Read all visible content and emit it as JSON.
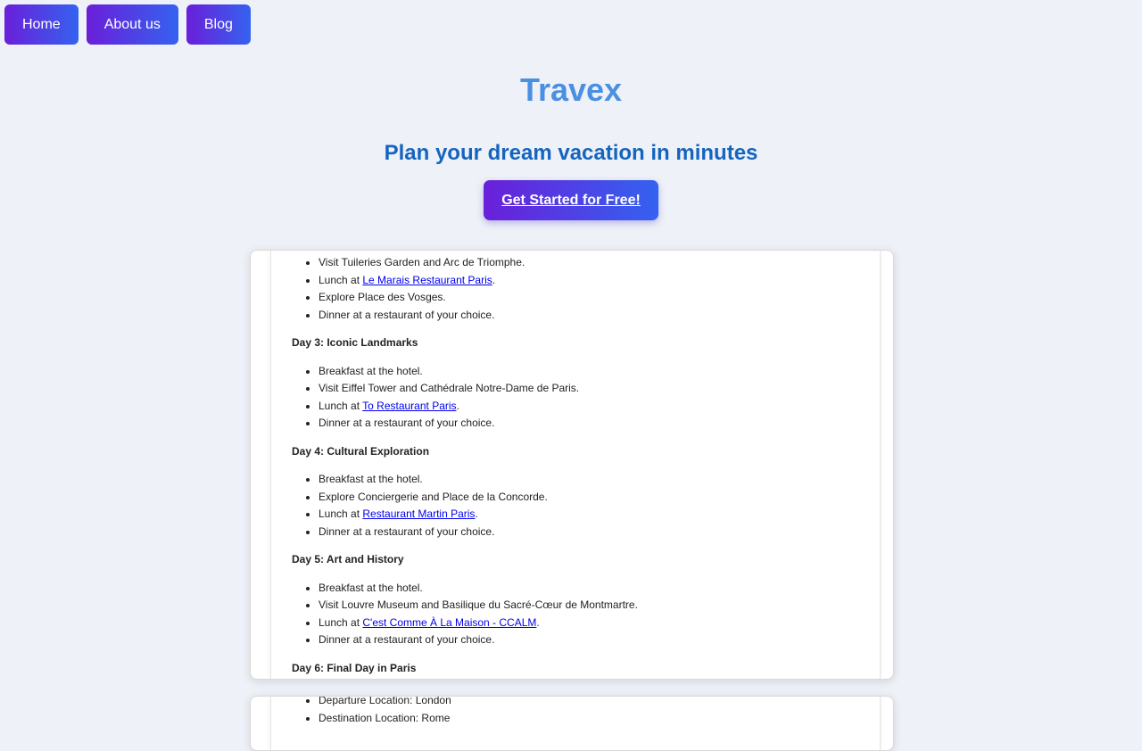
{
  "nav": {
    "home": "Home",
    "about": "About us",
    "blog": "Blog"
  },
  "hero": {
    "brand": "Travex",
    "tagline": "Plan your dream vacation in minutes",
    "cta": "Get Started for Free!"
  },
  "itinerary": {
    "day2_items": [
      {
        "text": "Visit Tuileries Garden and Arc de Triomphe."
      },
      {
        "pre": "Lunch at ",
        "link": "Le Marais Restaurant Paris",
        "post": "."
      },
      {
        "text": "Explore Place des Vosges."
      },
      {
        "text": "Dinner at a restaurant of your choice."
      }
    ],
    "day3_title": "Day 3: Iconic Landmarks",
    "day3_items": [
      {
        "text": "Breakfast at the hotel."
      },
      {
        "text": "Visit Eiffel Tower and Cathédrale Notre-Dame de Paris."
      },
      {
        "pre": "Lunch at ",
        "link": "To Restaurant Paris",
        "post": "."
      },
      {
        "text": "Dinner at a restaurant of your choice."
      }
    ],
    "day4_title": "Day 4: Cultural Exploration",
    "day4_items": [
      {
        "text": "Breakfast at the hotel."
      },
      {
        "text": "Explore Conciergerie and Place de la Concorde."
      },
      {
        "pre": "Lunch at ",
        "link": "Restaurant Martin Paris",
        "post": "."
      },
      {
        "text": "Dinner at a restaurant of your choice."
      }
    ],
    "day5_title": "Day 5: Art and History",
    "day5_items": [
      {
        "text": "Breakfast at the hotel."
      },
      {
        "text": "Visit Louvre Museum and Basilique du Sacré-Cœur de Montmartre."
      },
      {
        "pre": "Lunch at ",
        "link": "C'est Comme À La Maison - CCALM",
        "post": "."
      },
      {
        "text": "Dinner at a restaurant of your choice."
      }
    ],
    "day6_title": "Day 6: Final Day in Paris"
  },
  "second_card": {
    "departure": "Departure Location: London",
    "destination": "Destination Location: Rome"
  }
}
